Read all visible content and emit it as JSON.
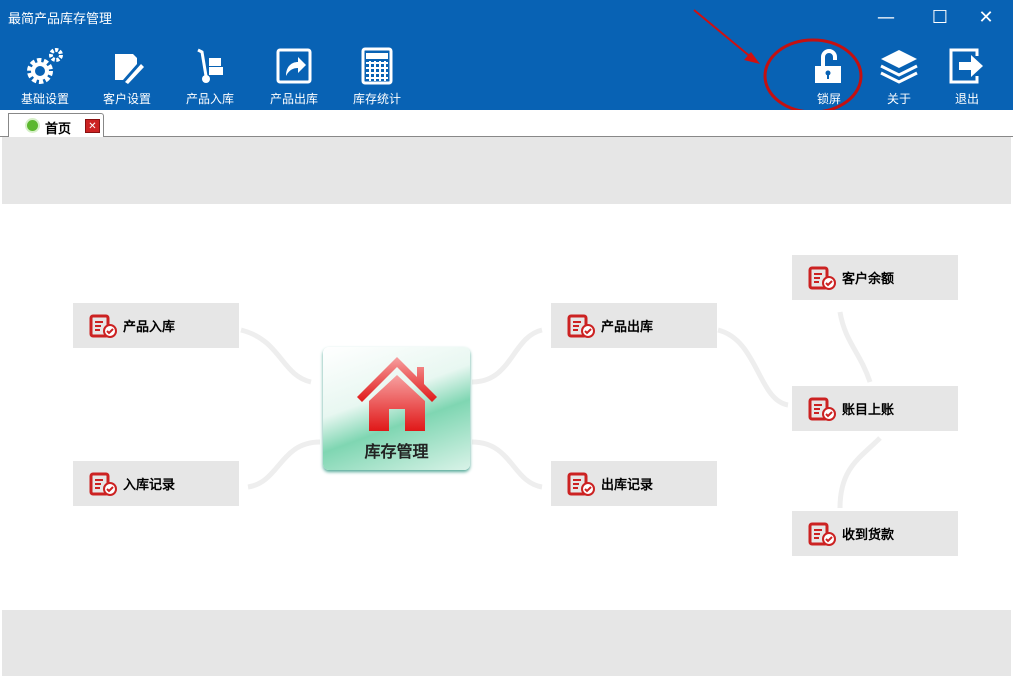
{
  "window": {
    "title": "最简产品库存管理"
  },
  "toolbar": {
    "left": [
      {
        "label": "基础设置",
        "icon": "gears-icon"
      },
      {
        "label": "客户设置",
        "icon": "document-edit-icon"
      },
      {
        "label": "产品入库",
        "icon": "hand-truck-icon"
      },
      {
        "label": "产品出库",
        "icon": "export-arrow-icon"
      },
      {
        "label": "库存统计",
        "icon": "calculator-icon"
      }
    ],
    "right": [
      {
        "label": "锁屏",
        "icon": "unlock-icon"
      },
      {
        "label": "关于",
        "icon": "layers-icon"
      },
      {
        "label": "退出",
        "icon": "exit-icon"
      }
    ]
  },
  "tabs": [
    {
      "label": "首页"
    }
  ],
  "flow": {
    "center": "库存管理",
    "nodes": [
      "产品入库",
      "入库记录",
      "产品出库",
      "出库记录",
      "客户余额",
      "账目上账",
      "收到货款"
    ]
  },
  "colors": {
    "titlebar": "#0862b4",
    "band": "#e6e6e6",
    "annotation": "#d01010"
  }
}
